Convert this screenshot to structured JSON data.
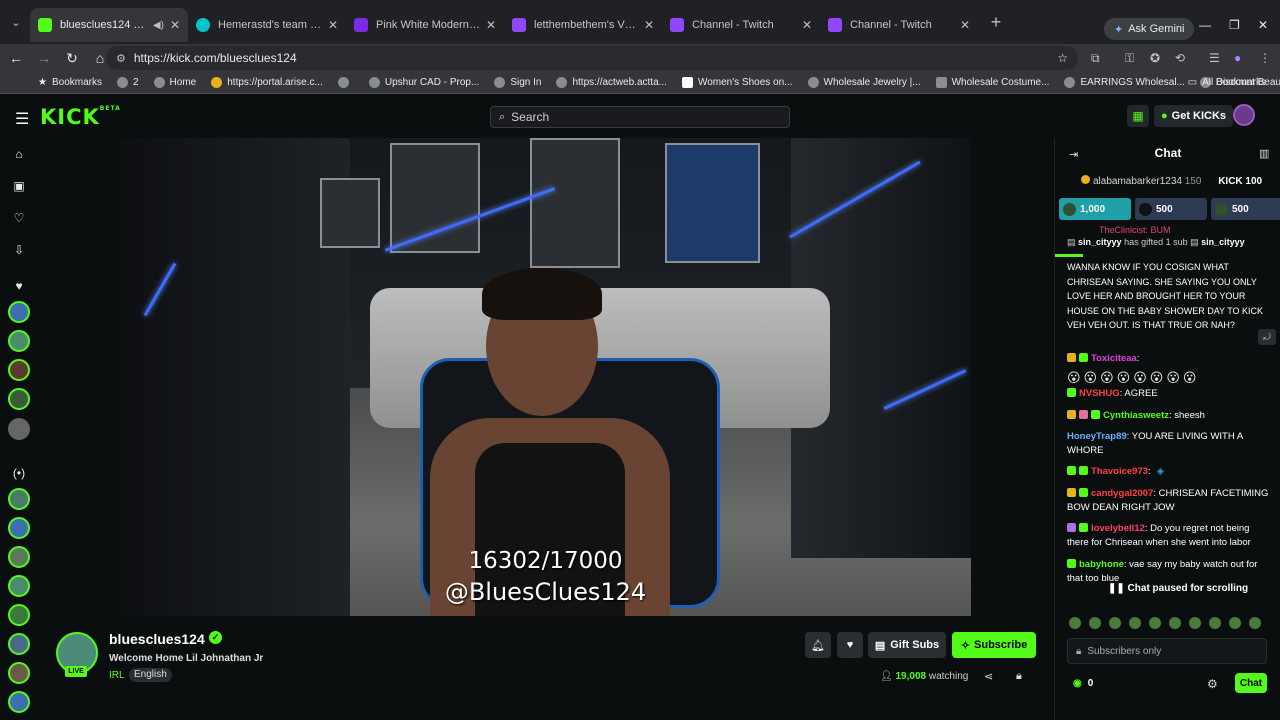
{
  "browser": {
    "tabs": [
      {
        "title": "bluesclues124 Stream - Wat",
        "active": true,
        "favicon_color": "#53fc18"
      },
      {
        "title": "Hemerastd's team – Canva",
        "active": false,
        "favicon_color": "#00c4cc"
      },
      {
        "title": "Pink White Modern Stream Star",
        "active": false,
        "favicon_color": "#7d2ae8"
      },
      {
        "title": "letthembethem's Videos - Twitc",
        "active": false,
        "favicon_color": "#9146ff"
      },
      {
        "title": "Channel - Twitch",
        "active": false,
        "favicon_color": "#9146ff"
      },
      {
        "title": "Channel - Twitch",
        "active": false,
        "favicon_color": "#9146ff"
      }
    ],
    "gemini_label": "Ask Gemini",
    "url": "https://kick.com/bluesclues124",
    "bookmarks": [
      {
        "label": "Bookmarks"
      },
      {
        "label": "2"
      },
      {
        "label": "Home"
      },
      {
        "label": "https://portal.arise.c..."
      },
      {
        "label": ""
      },
      {
        "label": "Upshur CAD - Prop..."
      },
      {
        "label": "Sign In"
      },
      {
        "label": "https://actweb.actta..."
      },
      {
        "label": "Women's Shoes on..."
      },
      {
        "label": "Wholesale Jewelry |..."
      },
      {
        "label": "Wholesale Costume..."
      },
      {
        "label": "EARRINGS Wholesal..."
      },
      {
        "label": "Discount Beauty Pro..."
      }
    ],
    "all_bookmarks": "All Bookmarks"
  },
  "kick": {
    "search_placeholder": "Search",
    "get_kicks": "Get KICKs"
  },
  "stream": {
    "overlay_count": "16302/17000",
    "overlay_handle": "@BluesClues124",
    "channel_name": "bluesclues124",
    "live_label": "LIVE",
    "title": "Welcome Home Lil Johnathan Jr",
    "category": "IRL",
    "language": "English",
    "gift_subs": "Gift Subs",
    "subscribe": "Subscribe",
    "viewers": "19,008",
    "viewers_suffix": "watching"
  },
  "chat": {
    "title": "Chat",
    "pinned_user": "alabamabarker1234",
    "pinned_amount": "150",
    "pinned_kick": "KICK 100",
    "gift_bars": [
      {
        "value": "1,000",
        "color": "#1fa0a8"
      },
      {
        "value": "500",
        "color": "#2f3a55"
      },
      {
        "value": "500",
        "color": "#2f3a55"
      }
    ],
    "cut_name": "TheClinicist: BUM",
    "sub_gift_user": "sin_cityyy",
    "sub_gift_text": "has gifted 1 sub",
    "sub_gift_user2": "sin_cityyy",
    "long_message": "WANNA KNOW IF YOU COSIGN WHAT CHRISEAN SAYING. SHE SAYING YOU ONLY LOVE HER AND BROUGHT HER TO YOUR HOUSE ON THE BABY SHOWER DAY TO KICK VEH VEH OUT. IS THAT TRUE OR NAH?",
    "messages": [
      {
        "user": "Toxiciteaa",
        "text": ":",
        "color": "#e040e0"
      },
      {
        "user": "NVSHUG",
        "text": ": AGREE",
        "color": "#ff4040"
      },
      {
        "user": "Cynthiasweetz",
        "text": ": sheesh",
        "color": "#53fc18"
      },
      {
        "user": "HoneyTrap89",
        "text": ": YOU ARE LIVING WITH A WHORE",
        "color": "#6ab0ff"
      },
      {
        "user": "Thavoice973",
        "text": ":",
        "color": "#ff4040"
      },
      {
        "user": "candygal2007",
        "text": ": CHRISEAN FACETIMING BOW DEAN RIGHT JOW",
        "color": "#ff4040"
      },
      {
        "user": "lovelybell12",
        "text": ": Do you regret not being there for Chrisean when she went into labor",
        "color": "#ff4060"
      },
      {
        "user": "babyhone",
        "text": ": vae say my baby watch out for that too blue",
        "color": "#53fc18"
      }
    ],
    "paused_label": "Chat paused for scrolling",
    "input_placeholder": "Subscribers only",
    "points": "0",
    "send_label": "Chat"
  }
}
